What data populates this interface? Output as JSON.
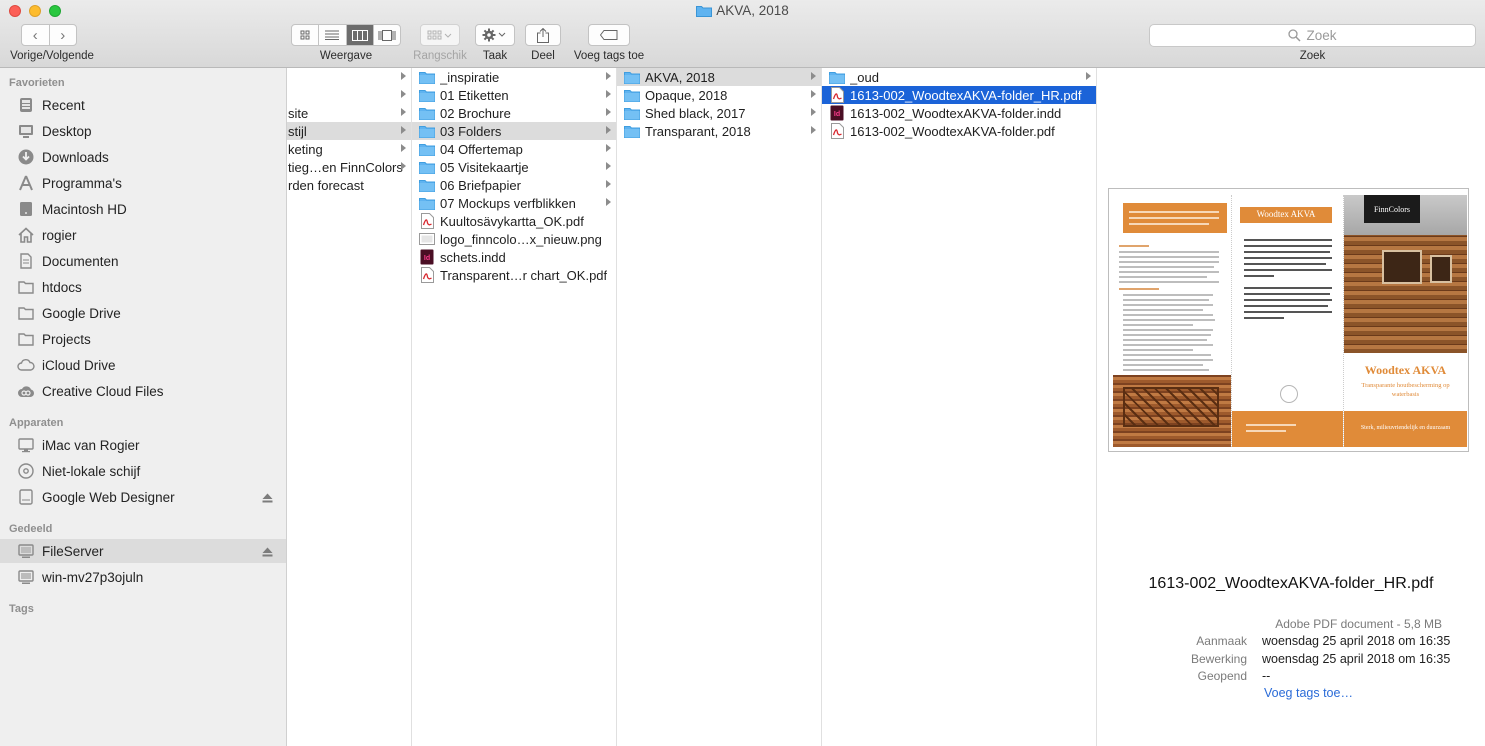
{
  "window": {
    "title": "AKVA, 2018"
  },
  "toolbar": {
    "nav_label": "Vorige/Volgende",
    "view_label": "Weergave",
    "arrange_label": "Rangschik",
    "action_label": "Taak",
    "share_label": "Deel",
    "tags_label": "Voeg tags toe",
    "search_placeholder": "Zoek",
    "search_label": "Zoek"
  },
  "sidebar": {
    "favorites_heading": "Favorieten",
    "favorites": [
      {
        "label": "Recent",
        "icon": "recent-icon"
      },
      {
        "label": "Desktop",
        "icon": "desktop-icon"
      },
      {
        "label": "Downloads",
        "icon": "downloads-icon"
      },
      {
        "label": "Programma's",
        "icon": "applications-icon"
      },
      {
        "label": "Macintosh HD",
        "icon": "hard-drive-icon"
      },
      {
        "label": "rogier",
        "icon": "home-icon"
      },
      {
        "label": "Documenten",
        "icon": "documents-icon"
      },
      {
        "label": "htdocs",
        "icon": "folder-icon"
      },
      {
        "label": "Google Drive",
        "icon": "folder-icon"
      },
      {
        "label": "Projects",
        "icon": "folder-icon"
      },
      {
        "label": "iCloud Drive",
        "icon": "cloud-icon"
      },
      {
        "label": "Creative Cloud Files",
        "icon": "creative-cloud-icon"
      }
    ],
    "devices_heading": "Apparaten",
    "devices": [
      {
        "label": "iMac van Rogier",
        "icon": "imac-icon"
      },
      {
        "label": "Niet-lokale schijf",
        "icon": "disc-icon"
      },
      {
        "label": "Google Web Designer",
        "icon": "drive-icon"
      }
    ],
    "shared_heading": "Gedeeld",
    "shared": [
      {
        "label": "FileServer",
        "icon": "server-icon"
      },
      {
        "label": "win-mv27p3ojuln",
        "icon": "server-icon"
      }
    ],
    "tags_heading": "Tags"
  },
  "columns": {
    "col1": [
      "site",
      "stijl",
      "keting",
      "tieg…en FinnColors",
      "rden forecast"
    ],
    "col2": [
      {
        "label": "_inspiratie",
        "type": "folder"
      },
      {
        "label": "01 Etiketten",
        "type": "folder"
      },
      {
        "label": "02 Brochure",
        "type": "folder"
      },
      {
        "label": "03 Folders",
        "type": "folder"
      },
      {
        "label": "04 Offertemap",
        "type": "folder"
      },
      {
        "label": "05 Visitekaartje",
        "type": "folder"
      },
      {
        "label": "06 Briefpapier",
        "type": "folder"
      },
      {
        "label": "07 Mockups verfblikken",
        "type": "folder"
      },
      {
        "label": "Kuultosävykartta_OK.pdf",
        "type": "pdf"
      },
      {
        "label": "logo_finncolo…x_nieuw.png",
        "type": "png"
      },
      {
        "label": "schets.indd",
        "type": "indd"
      },
      {
        "label": "Transparent…r chart_OK.pdf",
        "type": "pdf"
      }
    ],
    "col3": [
      {
        "label": "AKVA, 2018",
        "type": "folder"
      },
      {
        "label": "Opaque, 2018",
        "type": "folder"
      },
      {
        "label": "Shed black, 2017",
        "type": "folder"
      },
      {
        "label": "Transparant, 2018",
        "type": "folder"
      }
    ],
    "col4": [
      {
        "label": "_oud",
        "type": "folder"
      },
      {
        "label": "1613-002_WoodtexAKVA-folder_HR.pdf",
        "type": "pdf"
      },
      {
        "label": "1613-002_WoodtexAKVA-folder.indd",
        "type": "indd"
      },
      {
        "label": "1613-002_WoodtexAKVA-folder.pdf",
        "type": "pdf"
      }
    ]
  },
  "preview": {
    "filename": "1613-002_WoodtexAKVA-folder_HR.pdf",
    "kind": "Adobe PDF document - 5,8 MB",
    "created_label": "Aanmaak",
    "created_value": "woensdag 25 april 2018 om 16:35",
    "modified_label": "Bewerking",
    "modified_value": "woensdag 25 april 2018 om 16:35",
    "opened_label": "Geopend",
    "opened_value": "--",
    "add_tags": "Voeg tags toe…",
    "thumb": {
      "brand": "Woodtex AKVA",
      "logo": "FinnColors",
      "subtitle": "Transparante houtbescherming op waterbasis",
      "footer": "Sterk, milieuvriendelijk en duurzaam"
    }
  },
  "colors": {
    "selection_blue": "#1b63d8",
    "folder_blue": "#5fb3f0",
    "brochure_orange": "#e08b39"
  }
}
